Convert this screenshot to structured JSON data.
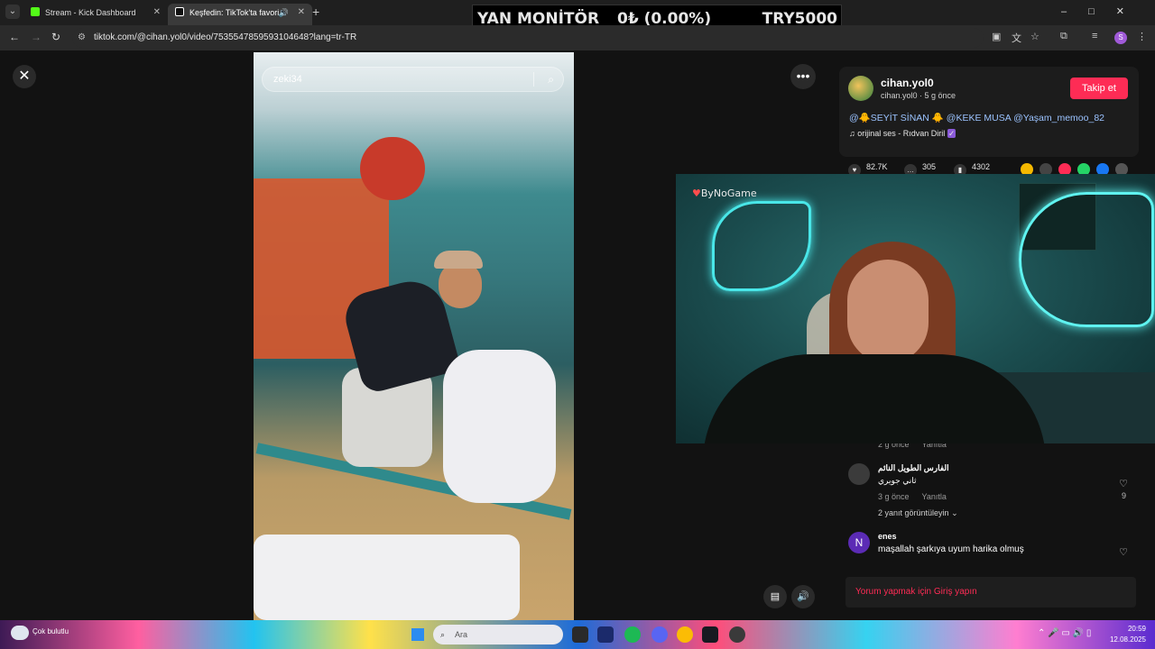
{
  "browser": {
    "tabs": [
      {
        "title": "Stream - Kick Dashboard",
        "favicon_color": "#53fc18",
        "active": false
      },
      {
        "title": "Keşfedin: TikTok'ta favori vi",
        "favicon_color": "#ffffff",
        "active": true
      }
    ],
    "url": "tiktok.com/@cihan.yol0/video/7535547859593104648?lang=tr-TR",
    "profile_initial": "S"
  },
  "overlay": {
    "title": "YAN MONİTÖR",
    "value": "0₺ (0.00%)",
    "goal": "TRY5000"
  },
  "video": {
    "search_text": "zeki34"
  },
  "author": {
    "username": "cihan.yol0",
    "meta": "cihan.yol0 · 5 g önce",
    "follow_label": "Takip et",
    "caption": "@🐥SEYİT SİNAN 🐥 @KEKE MUSA @Yaşam_memoo_82",
    "music": "orijinal ses - Rıdvan Diril"
  },
  "stats": {
    "likes": "82.7K",
    "comments": "305",
    "saves": "4302"
  },
  "cam": {
    "label": "ByNoGame"
  },
  "comments": [
    {
      "meta_time": "2 g önce",
      "meta_reply": "Yanıtla"
    },
    {
      "name": "الفارس الطويل النائم",
      "text": "ثاني جويري",
      "time": "3 g önce",
      "reply": "Yanıtla",
      "likes": "9",
      "replies_link": "2 yanıt görüntüleyin"
    },
    {
      "avatar_letter": "N",
      "name": "enes",
      "text": "maşallah şarkıya uyum harika olmuş"
    }
  ],
  "login_prompt": "Yorum yapmak için Giriş yapın",
  "taskbar": {
    "weather": "Çok bulutlu",
    "search_placeholder": "Ara",
    "time": "20:59",
    "date": "12.08.2025"
  },
  "colors": {
    "accent": "#fe2c55",
    "neon": "#49e6e8"
  }
}
